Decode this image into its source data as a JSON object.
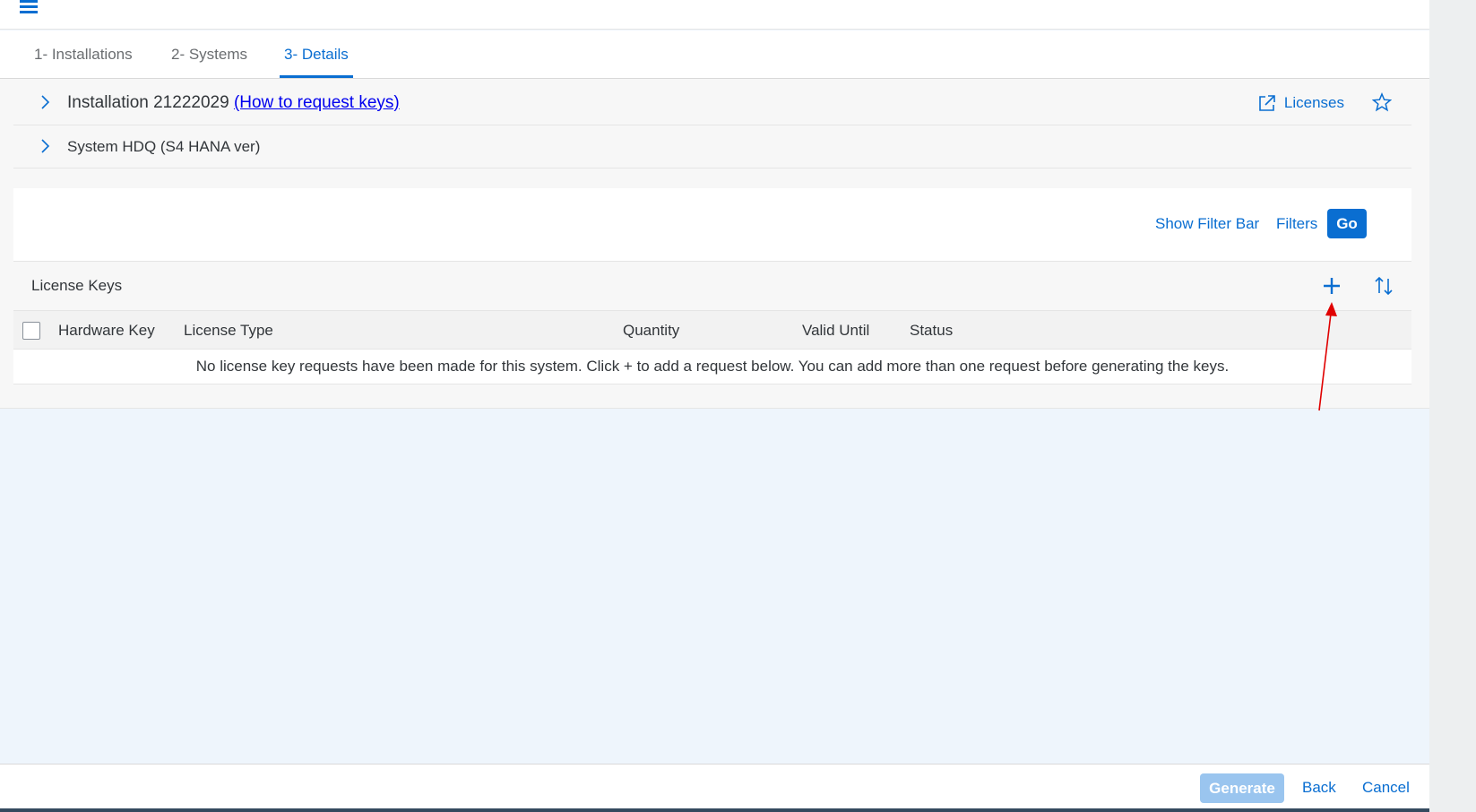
{
  "tabs": [
    {
      "label": "1- Installations"
    },
    {
      "label": "2- Systems"
    },
    {
      "label": "3- Details"
    }
  ],
  "installation": {
    "title": "Installation 21222029",
    "help_link": "(How to request keys)",
    "licenses_label": "Licenses"
  },
  "system": {
    "title": "System HDQ (S4 HANA ver)"
  },
  "filterbar": {
    "show_filter_bar": "Show Filter Bar",
    "filters": "Filters",
    "go": "Go"
  },
  "table": {
    "title": "License Keys",
    "columns": [
      "Hardware Key",
      "License Type",
      "Quantity",
      "Valid Until",
      "Status"
    ],
    "no_data": "No license key requests have been made for this system. Click + to add a request below. You can add more than one request before generating the keys."
  },
  "footer": {
    "generate": "Generate",
    "back": "Back",
    "cancel": "Cancel"
  },
  "colors": {
    "accent": "#0a6ed1",
    "annotation_arrow": "#e00000",
    "generate_disabled": "#9ac5ef"
  },
  "icons": [
    "menu-icon",
    "chevron-right-icon",
    "external-link-icon",
    "star-icon",
    "add-icon",
    "sort-icon"
  ]
}
